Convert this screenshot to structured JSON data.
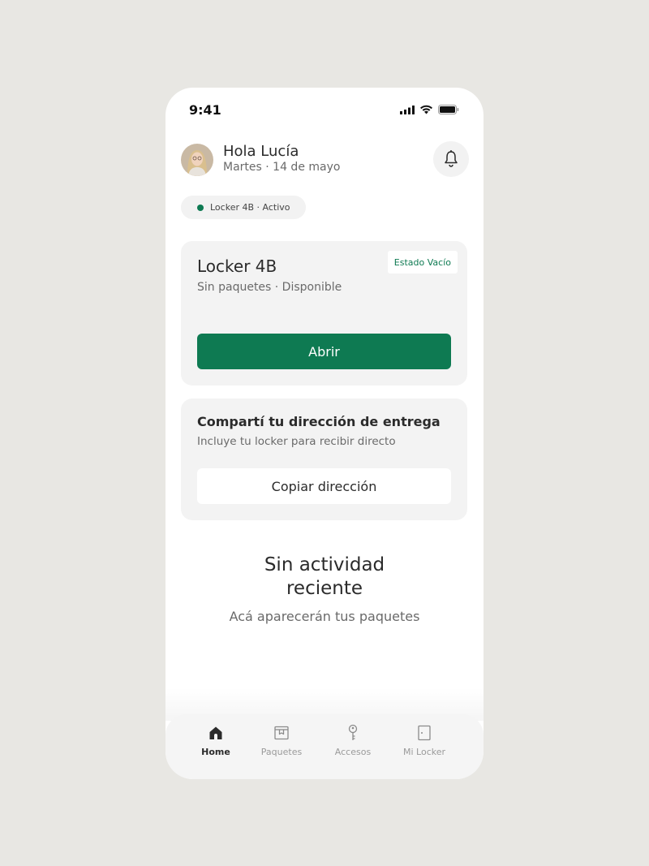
{
  "status_bar": {
    "time": "9:41"
  },
  "header": {
    "greeting": "Hola Lucía",
    "date": "Martes · 14 de mayo"
  },
  "locker_pill": {
    "text": "Locker 4B · Activo"
  },
  "locker_card": {
    "title": "Locker 4B",
    "subtitle": "Sin paquetes · Disponible",
    "badge": "Estado Vacío",
    "open_label": "Abrir"
  },
  "share_card": {
    "title": "Compartí tu dirección de entrega",
    "subtitle": "Incluye tu locker para recibir directo",
    "copy_label": "Copiar dirección"
  },
  "empty_state": {
    "title": "Sin actividad reciente",
    "subtitle": "Acá aparecerán tus paquetes"
  },
  "tabs": [
    {
      "label": "Home",
      "icon": "home-icon",
      "active": true
    },
    {
      "label": "Paquetes",
      "icon": "package-icon",
      "active": false
    },
    {
      "label": "Accesos",
      "icon": "key-icon",
      "active": false
    },
    {
      "label": "Mi Locker",
      "icon": "door-icon",
      "active": false
    }
  ],
  "colors": {
    "accent": "#0e7a52",
    "background": "#e8e7e3",
    "card": "#f3f3f3"
  }
}
